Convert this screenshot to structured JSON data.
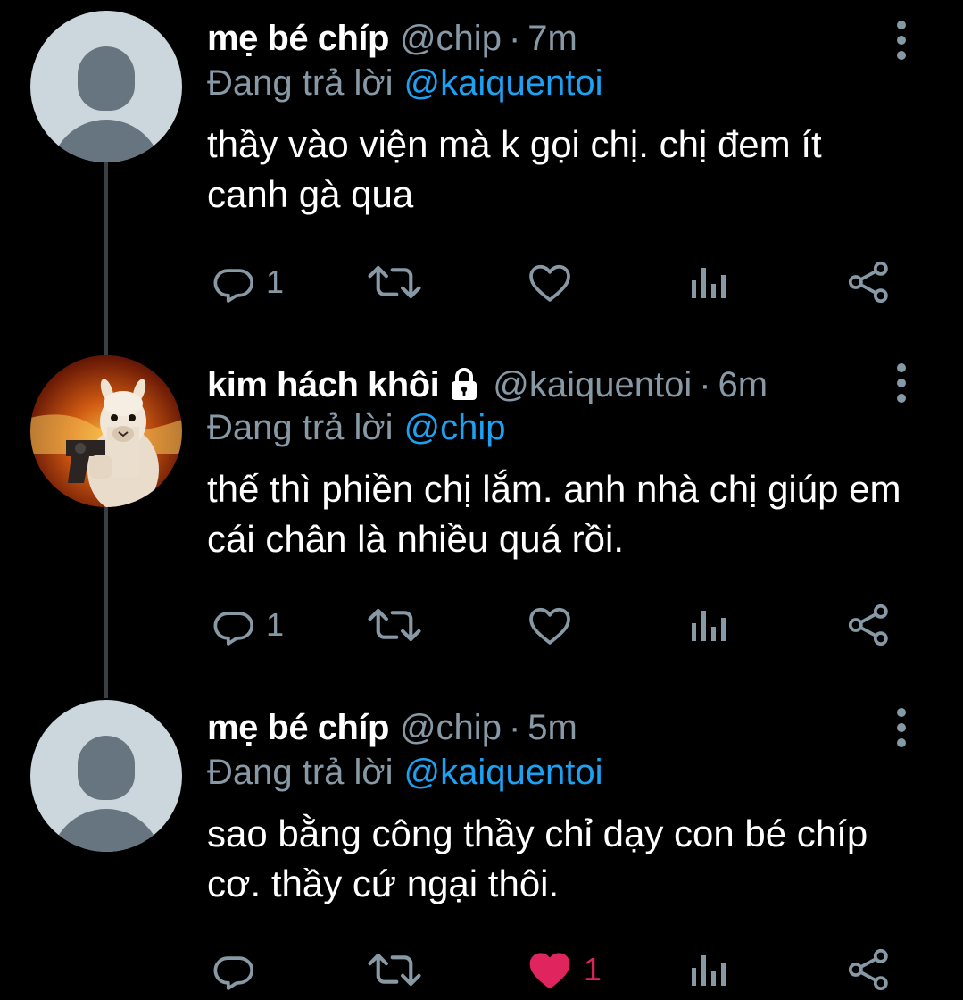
{
  "tweets": [
    {
      "display_name": "mẹ bé chíp",
      "handle": "@chip",
      "separator": "·",
      "time": "7m",
      "reply_prefix": "Đang trả lời",
      "reply_to": "@kaiquentoi",
      "text": "thầy vào viện mà k gọi chị. chị đem ít canh gà qua",
      "avatar": "default-avatar",
      "locked": false,
      "replies": "1",
      "retweets": "",
      "likes": "",
      "liked": false
    },
    {
      "display_name": "kim hách khôi",
      "handle": "@kaiquentoi",
      "separator": "·",
      "time": "6m",
      "reply_prefix": "Đang trả lời",
      "reply_to": "@chip",
      "text": "thế thì phiền chị lắm. anh nhà chị giúp em cái chân là nhiều quá rồi.",
      "avatar": "alpaca-with-gun-photo",
      "locked": true,
      "replies": "1",
      "retweets": "",
      "likes": "",
      "liked": false
    },
    {
      "display_name": "mẹ bé chíp",
      "handle": "@chip",
      "separator": "·",
      "time": "5m",
      "reply_prefix": "Đang trả lời",
      "reply_to": "@kaiquentoi",
      "text": "sao bằng công thầy chỉ dạy con bé chíp cơ. thầy cứ ngại thôi.",
      "avatar": "default-avatar",
      "locked": false,
      "replies": "",
      "retweets": "",
      "likes": "1",
      "liked": true
    }
  ],
  "icons": {
    "reply": "reply-icon",
    "retweet": "retweet-icon",
    "like": "heart-icon",
    "views": "analytics-icon",
    "share": "share-icon",
    "more": "more-vertical-icon",
    "lock": "lock-icon"
  },
  "colors": {
    "background": "#000000",
    "text_primary": "#ffffff",
    "text_secondary": "#8899a6",
    "link": "#1da1f2",
    "like_active": "#e0245e",
    "thread_line": "#3a3f44"
  }
}
